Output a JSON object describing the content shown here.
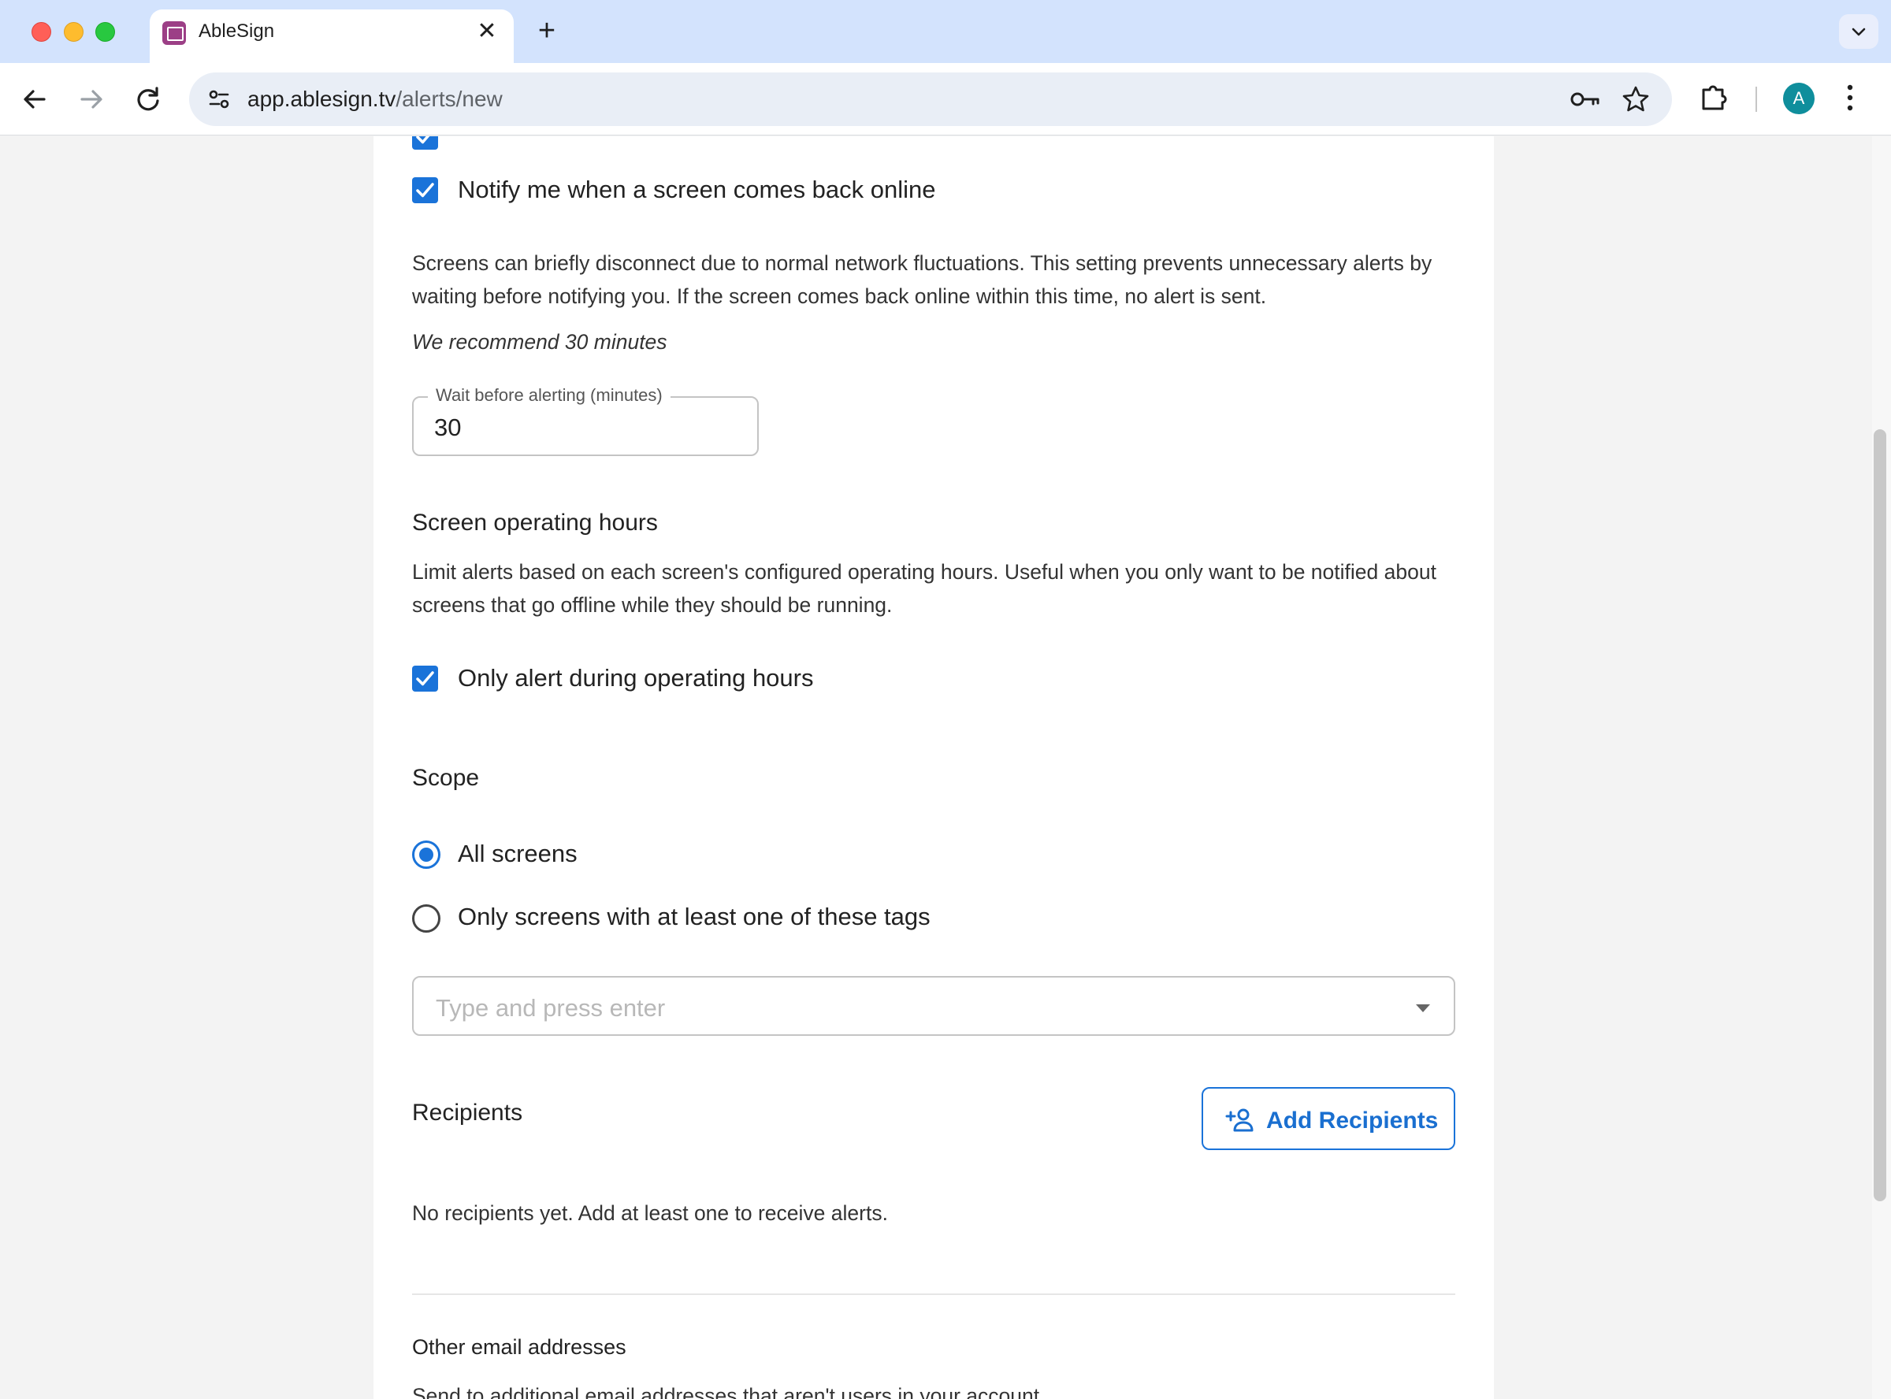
{
  "browser": {
    "tab_title": "AbleSign",
    "tab_close": "✕",
    "new_tab": "+",
    "url_host": "app.ablesign.tv",
    "url_path": "/alerts/new",
    "profile_initial": "A"
  },
  "notifications": {
    "back_online_label": "Notify me when a screen comes back online",
    "back_online_checked": true
  },
  "delay": {
    "description": "Screens can briefly disconnect due to normal network fluctuations. This setting prevents unnecessary alerts by waiting before notifying you. If the screen comes back online within this time, no alert is sent.",
    "recommendation": "We recommend 30 minutes",
    "field_label": "Wait before alerting (minutes)",
    "field_value": "30"
  },
  "operating_hours": {
    "title": "Screen operating hours",
    "description": "Limit alerts based on each screen's configured operating hours. Useful when you only want to be notified about screens that go offline while they should be running.",
    "checkbox_label": "Only alert during operating hours",
    "checked": true
  },
  "scope": {
    "title": "Scope",
    "options": [
      {
        "label": "All screens",
        "selected": true
      },
      {
        "label": "Only screens with at least one of these tags",
        "selected": false
      }
    ],
    "tags_placeholder": "Type and press enter"
  },
  "recipients": {
    "title": "Recipients",
    "add_button": "Add Recipients",
    "empty_text": "No recipients yet. Add at least one to receive alerts."
  },
  "other_emails": {
    "title": "Other email addresses",
    "description": "Send to additional email addresses that aren't users in your account"
  },
  "colors": {
    "accent": "#1a73d9",
    "tabbar": "#d3e3fd",
    "profile": "#0f8e9c",
    "favicon": "#9c3f86"
  }
}
